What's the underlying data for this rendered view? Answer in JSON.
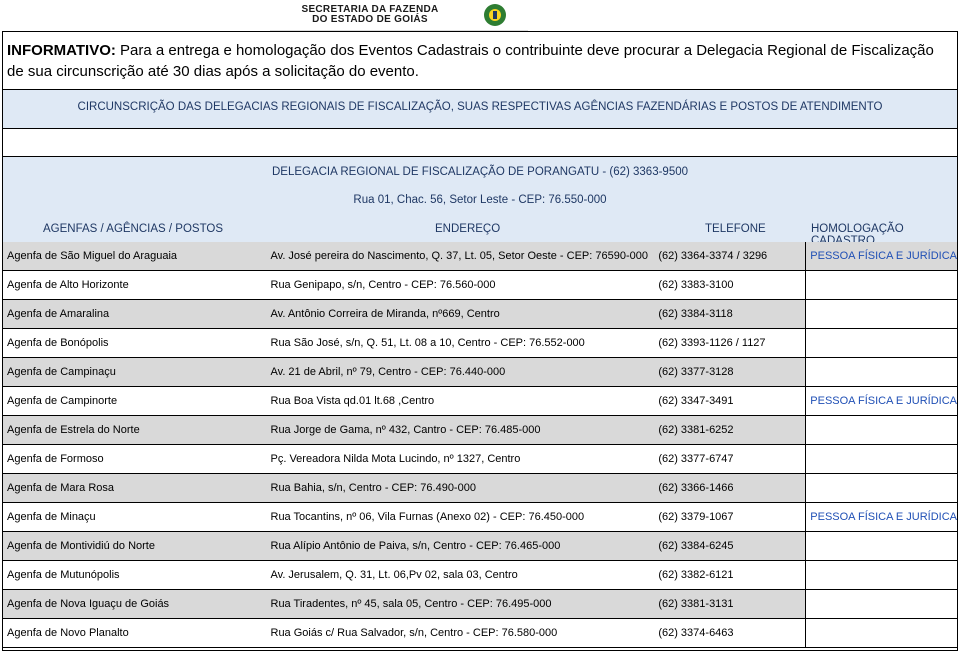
{
  "header": {
    "logo_line1": "SECRETARIA DA FAZENDA",
    "logo_line2": "DO ESTADO DE GOIÁS"
  },
  "info": {
    "label": "INFORMATIVO:",
    "text": "Para a entrega e homologação dos Eventos Cadastrais o contribuinte deve procurar a Delegacia Regional de Fiscalização de sua circunscrição até 30 dias após a solicitação do evento."
  },
  "circunscricao_title": "CIRCUNSCRIÇÃO DAS DELEGACIAS REGIONAIS DE FISCALIZAÇÃO, SUAS RESPECTIVAS AGÊNCIAS FAZENDÁRIAS E POSTOS DE ATENDIMENTO",
  "delegacia": {
    "title": "DELEGACIA REGIONAL DE FISCALIZAÇÃO DE PORANGATU - (62) 3363-9500",
    "address": "Rua 01, Chac. 56, Setor Leste - CEP: 76.550-000"
  },
  "columns": {
    "agencias": "AGENFAS / AGÊNCIAS / POSTOS",
    "endereco": "ENDEREÇO",
    "telefone": "TELEFONE",
    "homologacao": "HOMOLOGAÇÃO CADASTRO"
  },
  "rows": [
    {
      "name": "Agenfa de São Miguel do Araguaia",
      "address": "Av. José pereira do Nascimento, Q. 37, Lt. 05, Setor Oeste - CEP: 76590-000",
      "phone": "(62) 3364-3374 / 3296",
      "homologacao": "PESSOA FÍSICA E JURÍDICA",
      "shaded": true
    },
    {
      "name": "Agenfa de Alto Horizonte",
      "address": "Rua Genipapo, s/n, Centro - CEP: 76.560-000",
      "phone": "(62) 3383-3100",
      "homologacao": "",
      "shaded": false
    },
    {
      "name": "Agenfa de Amaralina",
      "address": "Av. Antônio Correira de Miranda, nº669, Centro",
      "phone": "(62) 3384-3118",
      "homologacao": "",
      "shaded": true
    },
    {
      "name": "Agenfa de Bonópolis",
      "address": "Rua São José, s/n, Q. 51, Lt. 08 a 10, Centro - CEP: 76.552-000",
      "phone": "(62) 3393-1126 / 1127",
      "homologacao": "",
      "shaded": false
    },
    {
      "name": "Agenfa de Campinaçu",
      "address": "Av. 21 de Abril, nº 79, Centro - CEP: 76.440-000",
      "phone": "(62) 3377-3128",
      "homologacao": "",
      "shaded": true
    },
    {
      "name": "Agenfa de Campinorte",
      "address": "Rua Boa Vista qd.01 lt.68 ,Centro",
      "phone": "(62) 3347-3491",
      "homologacao": "PESSOA FÍSICA E JURÍDICA",
      "shaded": false
    },
    {
      "name": "Agenfa de Estrela do Norte",
      "address": "Rua Jorge de Gama, nº 432, Cantro - CEP: 76.485-000",
      "phone": "(62) 3381-6252",
      "homologacao": "",
      "shaded": true
    },
    {
      "name": "Agenfa de Formoso",
      "address": "Pç. Vereadora Nilda Mota Lucindo, nº 1327, Centro",
      "phone": "(62) 3377-6747",
      "homologacao": "",
      "shaded": false
    },
    {
      "name": "Agenfa de Mara Rosa",
      "address": "Rua Bahia, s/n, Centro - CEP: 76.490-000",
      "phone": "(62) 3366-1466",
      "homologacao": "",
      "shaded": true
    },
    {
      "name": "Agenfa de Minaçu",
      "address": "Rua Tocantins, nº 06, Vila Furnas (Anexo 02) - CEP: 76.450-000",
      "phone": "(62) 3379-1067",
      "homologacao": "PESSOA FÍSICA E JURÍDICA",
      "shaded": false
    },
    {
      "name": "Agenfa de Montividiú do Norte",
      "address": "Rua Alípio Antônio de Paiva, s/n, Centro - CEP: 76.465-000",
      "phone": "(62) 3384-6245",
      "homologacao": "",
      "shaded": true
    },
    {
      "name": "Agenfa de Mutunópolis",
      "address": "Av. Jerusalem, Q. 31, Lt. 06,Pv 02, sala 03,  Centro",
      "phone": "(62) 3382-6121",
      "homologacao": "",
      "shaded": false
    },
    {
      "name": "Agenfa de Nova Iguaçu de Goiás",
      "address": "Rua Tiradentes, nº 45, sala 05, Centro - CEP: 76.495-000",
      "phone": "(62) 3381-3131",
      "homologacao": "",
      "shaded": true
    },
    {
      "name": "Agenfa de Novo Planalto",
      "address": "Rua Goiás c/ Rua Salvador, s/n, Centro - CEP: 76.580-000",
      "phone": "(62) 3374-6463",
      "homologacao": "",
      "shaded": false
    }
  ]
}
